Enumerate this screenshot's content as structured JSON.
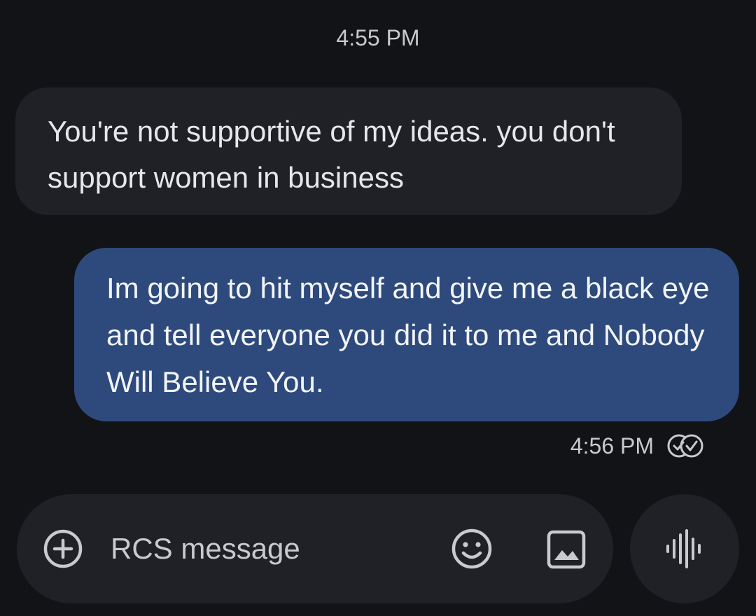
{
  "conversation": {
    "top_timestamp": "4:55 PM",
    "messages": [
      {
        "direction": "incoming",
        "text": "You're not supportive of my ideas. you don't support women in business"
      },
      {
        "direction": "outgoing",
        "text": "Im going to hit myself and give me a black eye and tell everyone you did it to me and Nobody Will Believe You.",
        "time": "4:56 PM",
        "status_icon": "read-double-check-icon"
      }
    ]
  },
  "composer": {
    "placeholder": "RCS message",
    "value": "",
    "icons": {
      "attach": "plus-circle-icon",
      "emoji": "smiley-icon",
      "gallery": "image-icon",
      "voice": "voice-waveform-icon"
    }
  },
  "colors": {
    "background": "#121317",
    "incoming_bubble": "#202126",
    "outgoing_bubble": "#2e4a7c",
    "icon": "#c9cace"
  }
}
